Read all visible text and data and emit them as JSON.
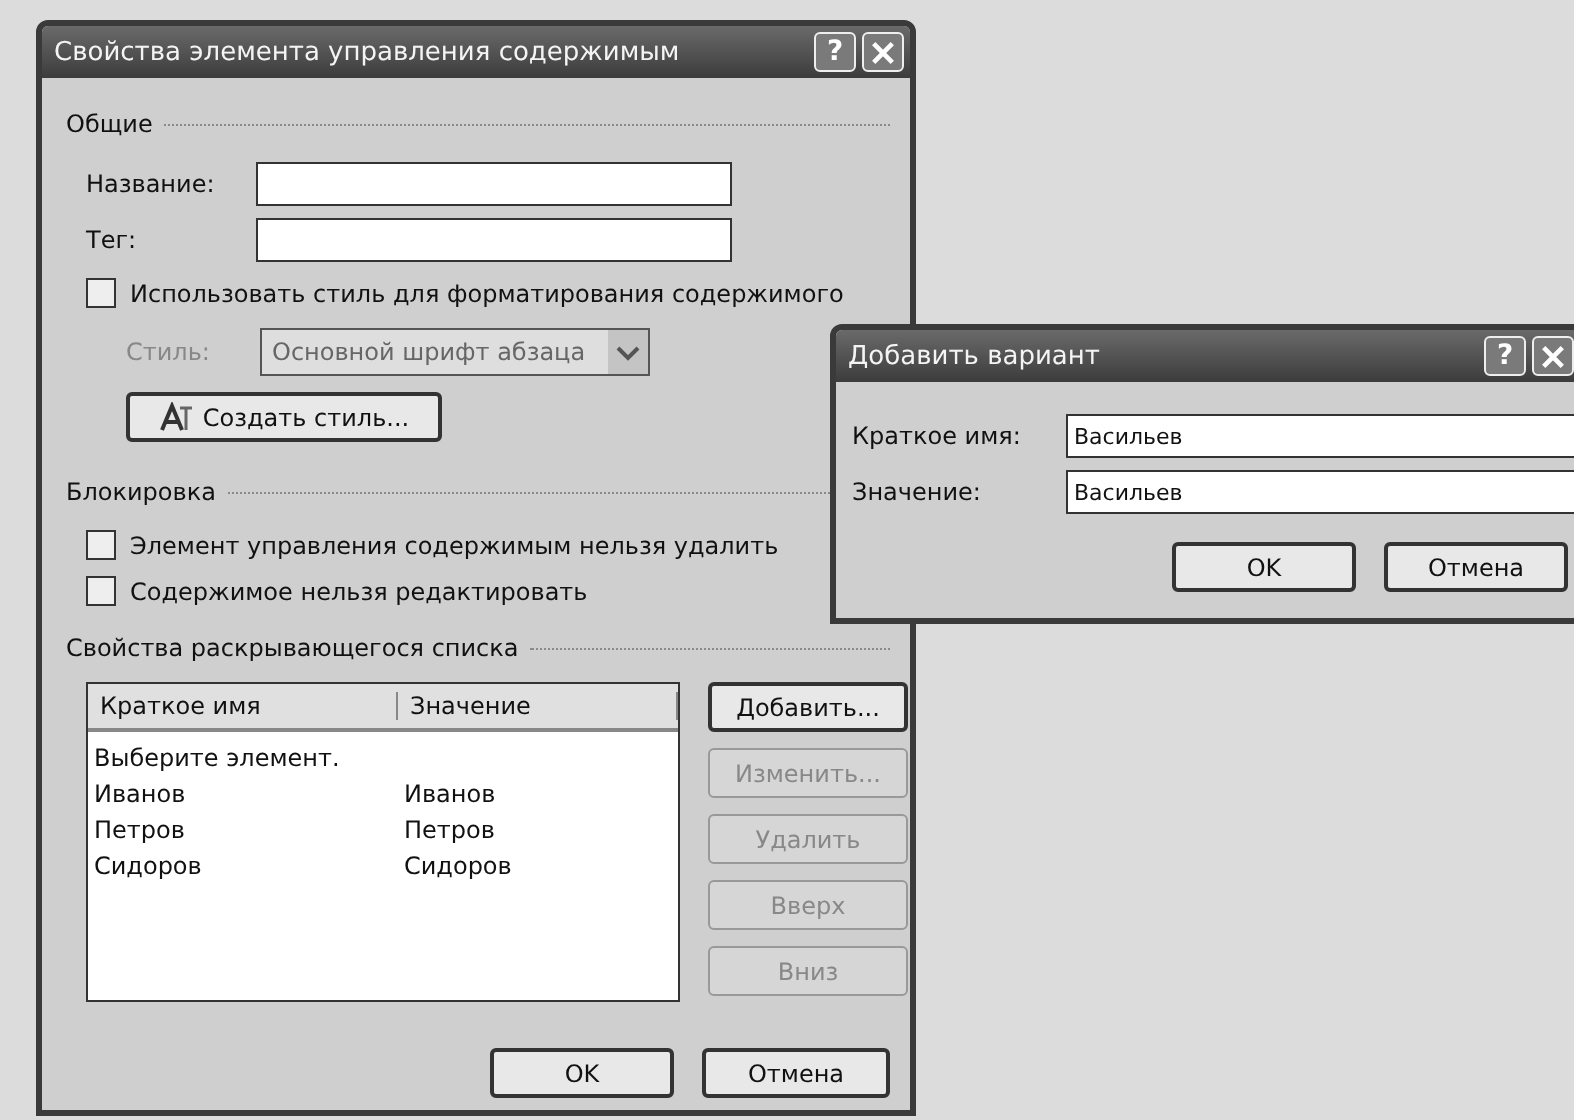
{
  "main_dialog": {
    "title": "Свойства элемента управления содержимым",
    "help": "?",
    "general": {
      "heading": "Общие",
      "fields": [
        {
          "label": "Название:"
        },
        {
          "label": "Тег:"
        }
      ],
      "use_style": {
        "label": "Использовать стиль для форматирования содержимого",
        "checked": false
      },
      "style": {
        "label": "Стиль:",
        "value": "Основной шрифт абзаца",
        "disabled": true
      },
      "new_style_button": {
        "label": "Создать стиль...",
        "disabled": false
      }
    },
    "locking": {
      "heading": "Блокировка",
      "options": [
        {
          "label": "Элемент управления содержимым нельзя удалить",
          "checked": false
        },
        {
          "label": "Содержимое нельзя редактировать",
          "checked": false
        }
      ]
    },
    "dropdown_properties": {
      "heading": "Свойства раскрывающегося списка",
      "columns": [
        "Краткое имя",
        "Значение"
      ],
      "rows": [
        {
          "name": "Выберите элемент."
        },
        {
          "name": "Иванов",
          "value": "Иванов"
        },
        {
          "name": "Петров",
          "value": "Петров"
        },
        {
          "name": "Сидоров",
          "value": "Сидоров"
        }
      ],
      "buttons": [
        {
          "label": "Добавить...",
          "disabled": false
        },
        {
          "label": "Изменить...",
          "disabled": true
        },
        {
          "label": "Удалить",
          "disabled": true
        },
        {
          "label": "Вверх",
          "disabled": true
        },
        {
          "label": "Вниз",
          "disabled": true
        }
      ]
    },
    "buttons": [
      "OK",
      "Отмена"
    ]
  },
  "add_dialog": {
    "title": "Добавить вариант",
    "help": "?",
    "fields": [
      {
        "label": "Краткое имя:",
        "value": "Васильев"
      },
      {
        "label": "Значение:",
        "value": "Васильев"
      }
    ],
    "buttons": [
      "OK",
      "Отмена"
    ]
  }
}
